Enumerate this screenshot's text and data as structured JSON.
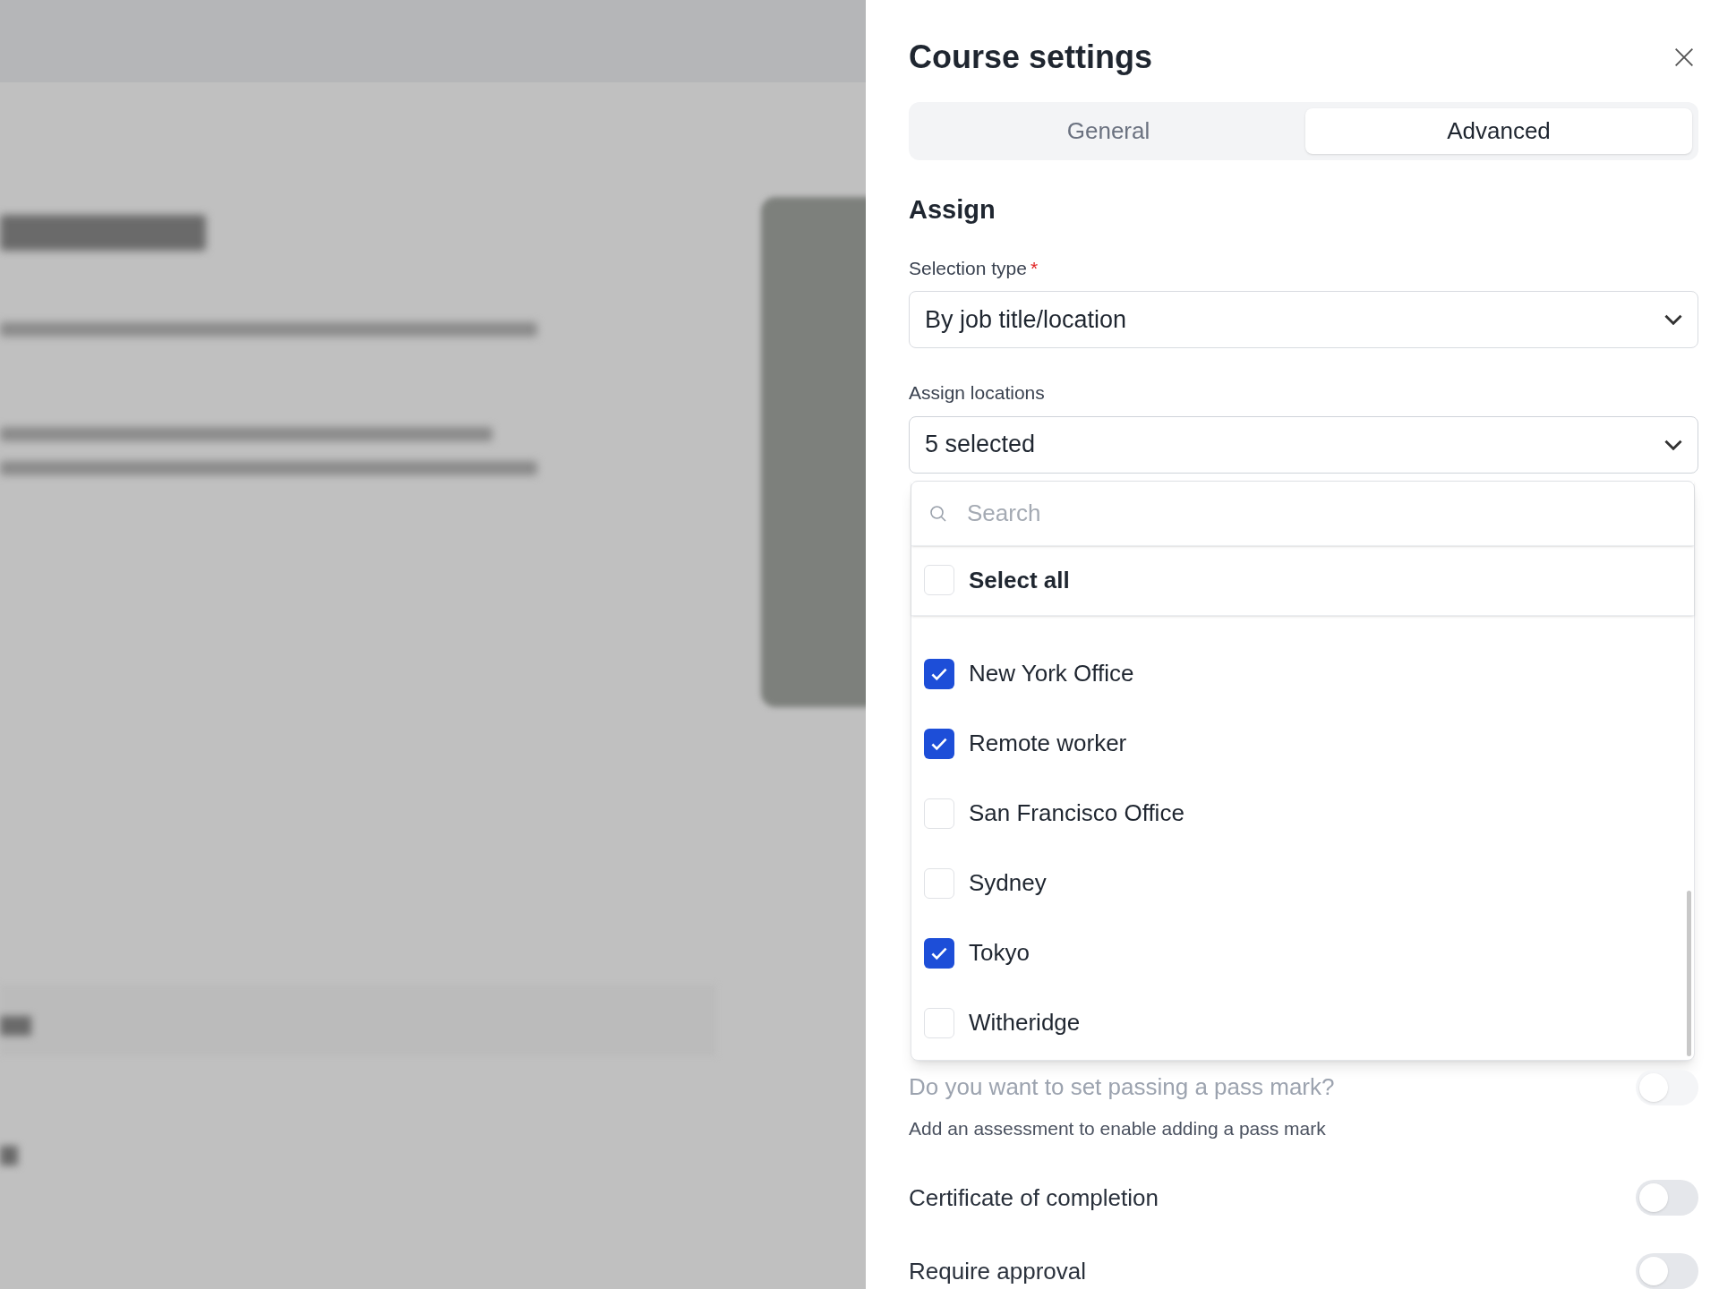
{
  "panel": {
    "title": "Course settings"
  },
  "tabs": [
    {
      "label": "General",
      "selected": false
    },
    {
      "label": "Advanced",
      "selected": true
    }
  ],
  "section": {
    "heading": "Assign"
  },
  "selection_type": {
    "label": "Selection type",
    "required_mark": "*",
    "value": "By job title/location"
  },
  "assign_locations": {
    "label": "Assign locations",
    "value": "5 selected",
    "expanded": true
  },
  "location_dropdown": {
    "search_placeholder": "Search",
    "select_all": {
      "label": "Select all",
      "checked": false
    },
    "options": [
      {
        "label": "New York Office",
        "checked": true
      },
      {
        "label": "Remote worker",
        "checked": true
      },
      {
        "label": "San Francisco Office",
        "checked": false
      },
      {
        "label": "Sydney",
        "checked": false
      },
      {
        "label": "Tokyo",
        "checked": true
      },
      {
        "label": "Witheridge",
        "checked": false
      }
    ]
  },
  "settings": [
    {
      "label": "Do you want to set passing a pass mark?",
      "hint": "Add an assessment to enable adding a pass mark",
      "on": false,
      "disabled": true
    },
    {
      "label": "Certificate of completion",
      "on": false,
      "disabled": false
    },
    {
      "label": "Require approval",
      "on": false,
      "disabled": false
    }
  ]
}
